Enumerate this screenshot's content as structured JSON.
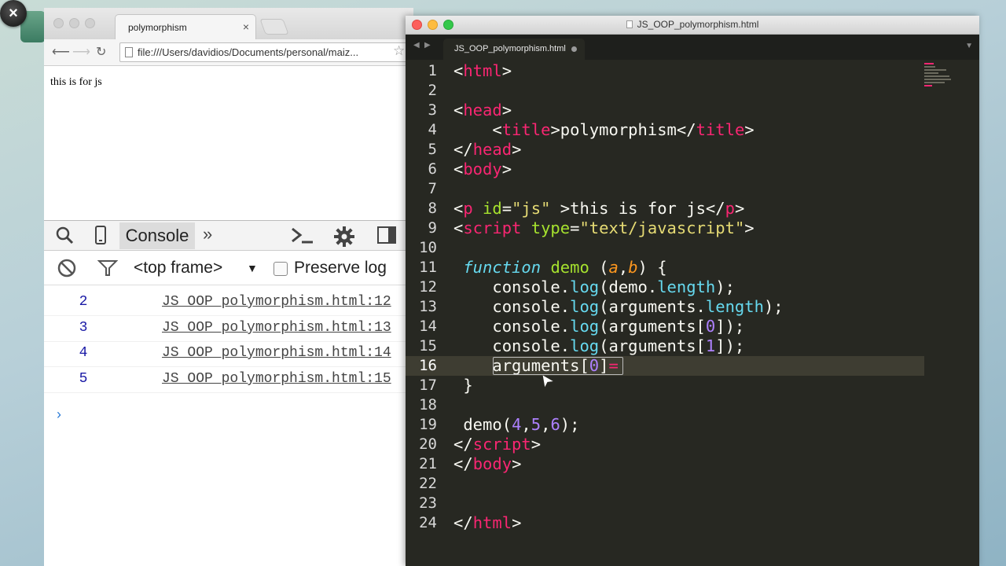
{
  "browser": {
    "tab_title": "polymorphism",
    "tab_close": "×",
    "url": "file:///Users/davidios/Documents/personal/maiz...",
    "page_text": "this is for js",
    "devtools": {
      "console_tab": "Console",
      "more_tabs": "»",
      "frame_selector": "<top frame>",
      "preserve_log_label": "Preserve log",
      "logs": [
        {
          "value": "2",
          "source": "JS_OOP_polymorphism.html:12"
        },
        {
          "value": "3",
          "source": "JS_OOP_polymorphism.html:13"
        },
        {
          "value": "4",
          "source": "JS_OOP_polymorphism.html:14"
        },
        {
          "value": "5",
          "source": "JS_OOP_polymorphism.html:15"
        }
      ],
      "prompt": "›"
    }
  },
  "editor": {
    "window_title": "JS_OOP_polymorphism.html",
    "tab_label": "JS_OOP_polymorphism.html",
    "line_numbers": [
      "1",
      "2",
      "3",
      "4",
      "5",
      "6",
      "7",
      "8",
      "9",
      "10",
      "11",
      "12",
      "13",
      "14",
      "15",
      "16",
      "17",
      "18",
      "19",
      "20",
      "21",
      "22",
      "23",
      "24"
    ],
    "current_line": 16
  },
  "colors": {
    "editor_bg": "#272822",
    "tag": "#f92672",
    "string": "#e6db74",
    "keyword": "#66d9ef",
    "function": "#a6e22e",
    "number": "#ae81ff",
    "argument": "#fd971f"
  }
}
